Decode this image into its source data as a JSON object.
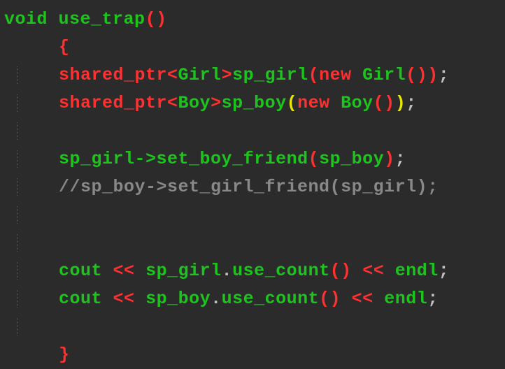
{
  "code": {
    "line1": {
      "kw": "void",
      "sp": " ",
      "fn": "use_trap",
      "lp": "(",
      "rp": ")"
    },
    "line2": {
      "brace": "{"
    },
    "line3": {
      "t1": "shared_ptr",
      "a1": "<",
      "t2": "Girl",
      "a2": ">",
      "v1": "sp_girl",
      "lp1": "(",
      "kw": "new",
      "sp2": " ",
      "t3": "Girl",
      "lp2": "(",
      "rp2": ")",
      "rp1": ")",
      "semi": ";"
    },
    "line4": {
      "t1": "shared_ptr",
      "a1": "<",
      "t2": "Boy",
      "a2": ">",
      "v1": "sp_boy",
      "lp1": "(",
      "kw": "new",
      "sp2": " ",
      "t3": "Boy",
      "lp2": "(",
      "rp2": ")",
      "rp1": ")",
      "semi": ";"
    },
    "line5": {
      "v1": "sp_girl",
      "arrow": "->",
      "fn": "set_boy_friend",
      "lp": "(",
      "arg": "sp_boy",
      "rp": ")",
      "semi": ";"
    },
    "line6": {
      "comment": "//sp_boy->set_girl_friend(sp_girl);"
    },
    "line7": {
      "c1": "cout",
      "sp1": " ",
      "op1": "<<",
      "sp2": " ",
      "v1": "sp_girl",
      "dot": ".",
      "fn": "use_count",
      "lp": "(",
      "rp": ")",
      "sp3": " ",
      "op2": "<<",
      "sp4": " ",
      "v2": "endl",
      "semi": ";"
    },
    "line8": {
      "c1": "cout",
      "sp1": " ",
      "op1": "<<",
      "sp2": " ",
      "v1": "sp_boy",
      "dot": ".",
      "fn": "use_count",
      "lp": "(",
      "rp": ")",
      "sp3": " ",
      "op2": "<<",
      "sp4": " ",
      "v2": "endl",
      "semi": ";"
    },
    "line9": {
      "brace": "}"
    }
  }
}
